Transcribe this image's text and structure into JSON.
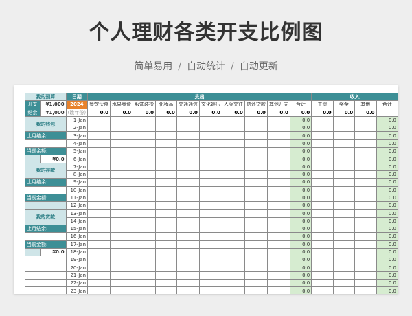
{
  "header": {
    "title": "个人理财各类开支比例图",
    "subtitle_items": [
      "简单易用",
      "自动统计",
      "自动更新"
    ]
  },
  "colors": {
    "teal": "#3d8f96",
    "orange": "#e8822c",
    "green_total": "#d6ecd0",
    "light_teal": "#cfe5e8"
  },
  "sheet": {
    "budget_title": "我的预算",
    "date_header": "日期",
    "expense_header": "支出",
    "income_header": "收入",
    "expense_categories": [
      "餐饮伙食",
      "水果零食",
      "服饰装扮",
      "化妆品",
      "交通通信",
      "文化娱乐",
      "人际交往",
      "信还贷款",
      "其他开支",
      "合计"
    ],
    "income_categories": [
      "工资",
      "奖金",
      "其他",
      "合计"
    ],
    "budget_rows": [
      {
        "label": "开支",
        "value": "¥1,000"
      },
      {
        "label": "结余",
        "value": "¥1,000"
      }
    ],
    "year": "2024",
    "year_hint": "(改年份)",
    "column_totals": [
      "0.0",
      "0.0",
      "0.0",
      "0.0",
      "0.0",
      "0.0",
      "0.0",
      "0.0",
      "0.0",
      "0.0",
      "0.0",
      "0.0",
      "0.0"
    ],
    "wallet": {
      "title": "我的钱包",
      "label1": "上月结余:",
      "label2": "当前余额:",
      "value": "¥0.0"
    },
    "deposit": {
      "title": "我的存款",
      "label1": "上月结余:",
      "label2": "当前金额:"
    },
    "loan": {
      "title": "我的贷款",
      "label1": "上月结余:",
      "label2": "当前金额:",
      "value": "¥0.0"
    },
    "dates": [
      "1-Jan",
      "2-Jan",
      "3-Jan",
      "4-Jan",
      "5-Jan",
      "6-Jan",
      "7-Jan",
      "8-Jan",
      "9-Jan",
      "10-Jan",
      "11-Jan",
      "12-Jan",
      "13-Jan",
      "14-Jan",
      "15-Jan",
      "16-Jan",
      "17-Jan",
      "18-Jan",
      "19-Jan",
      "20-Jan",
      "21-Jan",
      "22-Jan",
      "23-Jan"
    ],
    "row_total": "0.0"
  }
}
